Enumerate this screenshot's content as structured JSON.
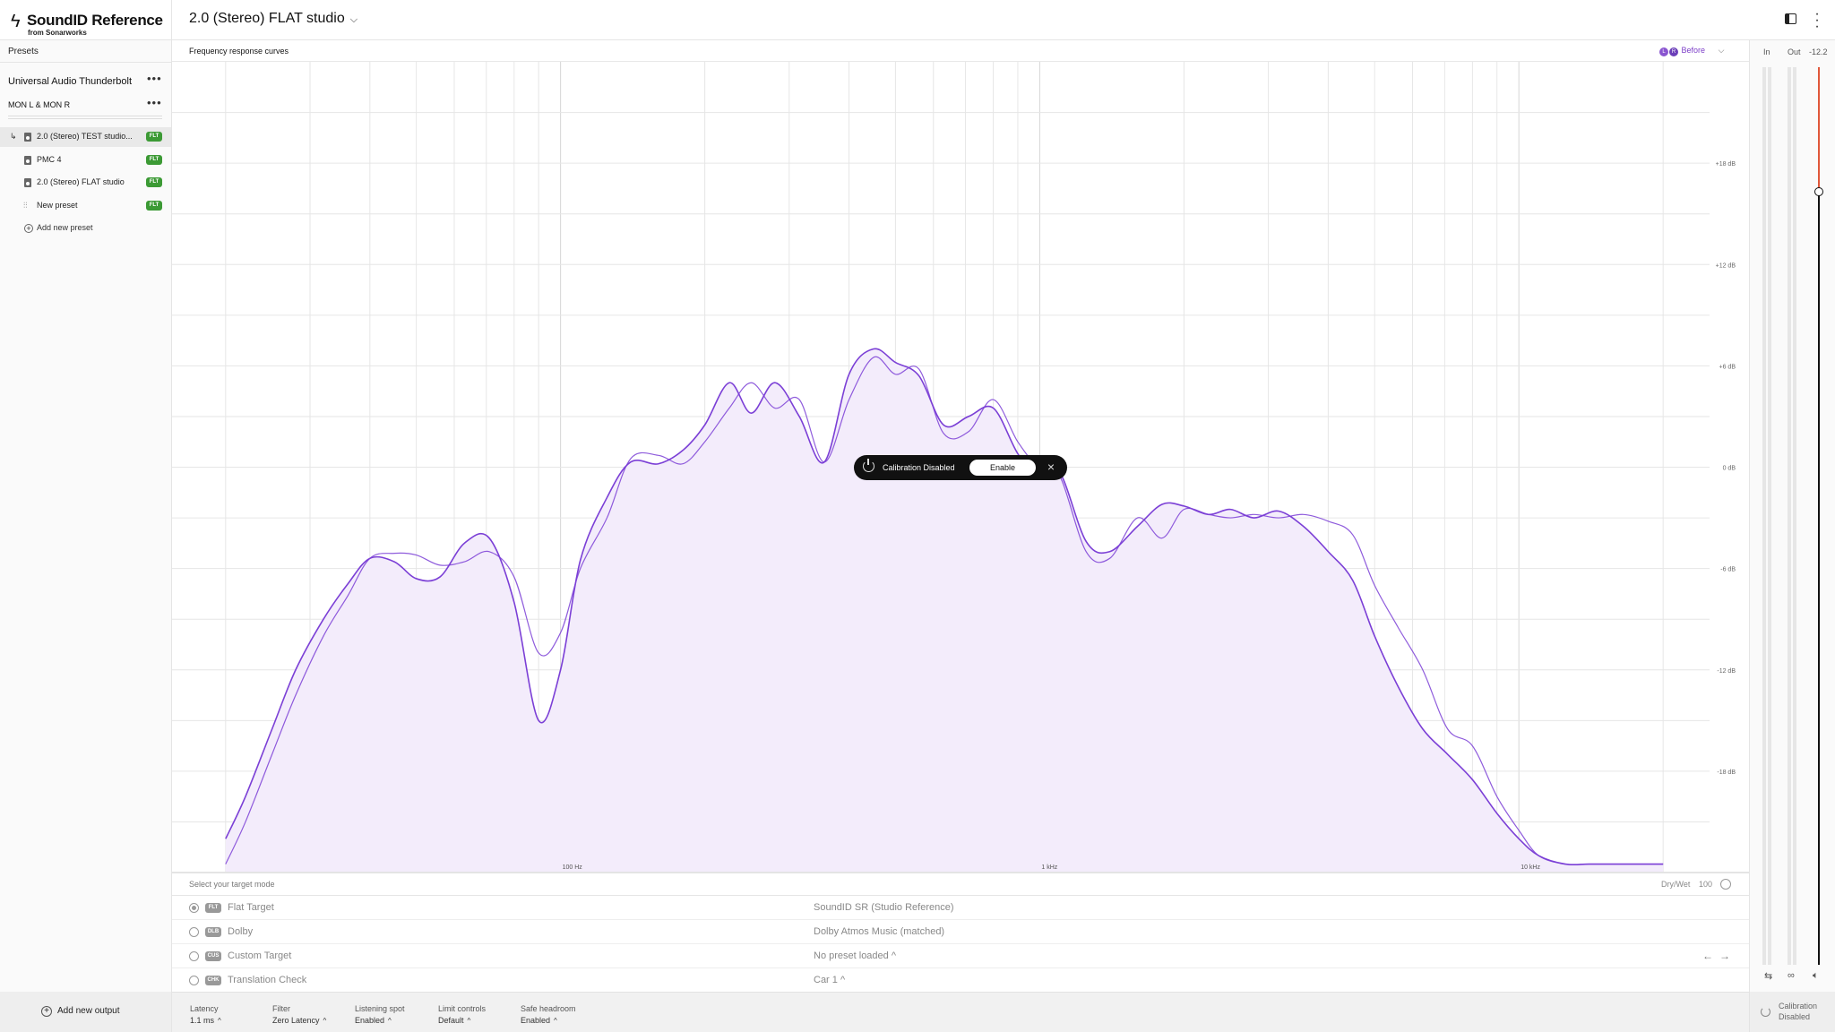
{
  "app": {
    "brand": "SoundID Reference",
    "brand_sub": "from Sonarworks",
    "current_preset": "2.0 (Stereo) FLAT studio"
  },
  "sidebar": {
    "presets_header": "Presets",
    "device": "Universal Audio Thunderbolt",
    "output": "MON L & MON R",
    "presets": [
      {
        "label": "2.0 (Stereo) TEST studio...",
        "badge": "FLT",
        "icon": "document-icon",
        "active": true
      },
      {
        "label": "PMC 4",
        "badge": "FLT",
        "icon": "document-icon",
        "active": false
      },
      {
        "label": "2.0 (Stereo) FLAT studio",
        "badge": "FLT",
        "icon": "document-icon",
        "active": false
      },
      {
        "label": "New preset",
        "badge": "FLT",
        "icon": "sliders-icon",
        "active": false
      }
    ],
    "add_preset": "Add new preset",
    "add_output": "Add new output"
  },
  "graph": {
    "title": "Frequency response curves",
    "toggle_label": "Before",
    "channels": [
      "L",
      "R"
    ]
  },
  "calibration_overlay": {
    "status": "Calibration Disabled",
    "button": "Enable"
  },
  "chart_data": {
    "type": "line",
    "x_scale": "log",
    "xlim": [
      16,
      25000
    ],
    "ylim": [
      -24,
      24
    ],
    "x_tick_labels": [
      {
        "value": 100,
        "label": "100 Hz"
      },
      {
        "value": 1000,
        "label": "1 kHz"
      },
      {
        "value": 10000,
        "label": "10 kHz"
      }
    ],
    "y_ticks": [
      18,
      12,
      6,
      0,
      -6,
      -12,
      -18
    ],
    "y_tick_labels": [
      "+18 dB",
      "+12 dB",
      "+6 dB",
      "0 dB",
      "-6 dB",
      "-12 dB",
      "-18 dB"
    ],
    "grid": true,
    "line_color": "#7b3fd6",
    "fill_color": "#f3ecfb",
    "series": [
      {
        "x": [
          20,
          22,
          25,
          28,
          32,
          36,
          40,
          45,
          50,
          56,
          63,
          71,
          80,
          90,
          100,
          110,
          125,
          140,
          160,
          180,
          200,
          225,
          250,
          280,
          315,
          355,
          400,
          450,
          500,
          560,
          630,
          710,
          800,
          900,
          1000,
          1100,
          1250,
          1400,
          1600,
          1800,
          2000,
          2250,
          2500,
          2800,
          3150,
          3550,
          4000,
          4500,
          5000,
          5600,
          6300,
          7100,
          8000,
          9000,
          10000,
          11000,
          12500,
          14000,
          16000,
          18000,
          20000
        ],
        "y": [
          -23.5,
          -21,
          -17,
          -13.5,
          -10,
          -7.6,
          -5.4,
          -5.1,
          -5.2,
          -5.8,
          -5.6,
          -5,
          -6.5,
          -11,
          -9.8,
          -6,
          -3,
          0.5,
          0.7,
          0.2,
          1.5,
          3.5,
          5,
          3.5,
          4,
          0.3,
          4,
          6.5,
          5.5,
          5.8,
          2,
          2.1,
          4,
          1.5,
          -0.1,
          -0.5,
          -5,
          -5.4,
          -3,
          -4.2,
          -2.5,
          -2.8,
          -3,
          -2.8,
          -3,
          -2.8,
          -3.2,
          -4,
          -7,
          -9.5,
          -12,
          -15.5,
          -16.5,
          -19.5,
          -21.5,
          -23,
          -23.5,
          -23.5,
          -23.5,
          -23.5,
          -23.5
        ]
      },
      {
        "x": [
          20,
          22,
          25,
          28,
          32,
          36,
          40,
          45,
          50,
          56,
          63,
          71,
          80,
          90,
          100,
          110,
          125,
          140,
          160,
          180,
          200,
          225,
          250,
          280,
          315,
          355,
          400,
          450,
          500,
          560,
          630,
          710,
          800,
          900,
          1000,
          1100,
          1250,
          1400,
          1600,
          1800,
          2000,
          2250,
          2500,
          2800,
          3150,
          3550,
          4000,
          4500,
          5000,
          5600,
          6300,
          7100,
          8000,
          9000,
          10000,
          11000,
          12500,
          14000,
          16000,
          18000,
          20000
        ],
        "y": [
          -22,
          -19.5,
          -15.5,
          -12,
          -9,
          -6.9,
          -5.4,
          -5.6,
          -6.6,
          -6.5,
          -4.5,
          -4.2,
          -8,
          -15,
          -12,
          -5.5,
          -1.8,
          0.3,
          0.2,
          1,
          2.5,
          5,
          3.2,
          5,
          3,
          0.3,
          5.5,
          7,
          6.2,
          5.4,
          2.5,
          3,
          3.5,
          0.8,
          -0.7,
          -0.3,
          -4.4,
          -5,
          -3.5,
          -2.2,
          -2.3,
          -2.8,
          -2.5,
          -3,
          -2.6,
          -3.5,
          -5,
          -6.7,
          -10,
          -13,
          -15.5,
          -17,
          -18.5,
          -20.5,
          -22,
          -23,
          -23.5,
          -23.5,
          -23.5,
          -23.5,
          -23.5
        ]
      }
    ]
  },
  "target": {
    "prompt": "Select your target mode",
    "dry_wet_label": "Dry/Wet",
    "dry_wet_value": "100",
    "rows": [
      {
        "tag": "FLT",
        "name": "Flat Target",
        "value": "SoundID SR (Studio Reference)",
        "selected": true
      },
      {
        "tag": "DLB",
        "name": "Dolby",
        "value": "Dolby Atmos Music (matched)",
        "selected": false
      },
      {
        "tag": "CUS",
        "name": "Custom Target",
        "value": "No preset loaded",
        "selected": false
      },
      {
        "tag": "CHK",
        "name": "Translation Check",
        "value": "Car 1",
        "selected": false
      }
    ]
  },
  "status": {
    "latency": {
      "label": "Latency",
      "value": "1.1 ms"
    },
    "filter": {
      "label": "Filter",
      "value": "Zero Latency"
    },
    "listening": {
      "label": "Listening spot",
      "value": "Enabled"
    },
    "limit": {
      "label": "Limit controls",
      "value": "Default"
    },
    "headroom": {
      "label": "Safe headroom",
      "value": "Enabled"
    }
  },
  "meter": {
    "in_label": "In",
    "out_label": "Out",
    "volume": "-12.2",
    "volume_level_fraction": 0.14,
    "calibration_status_line1": "Calibration",
    "calibration_status_line2": "Disabled"
  }
}
